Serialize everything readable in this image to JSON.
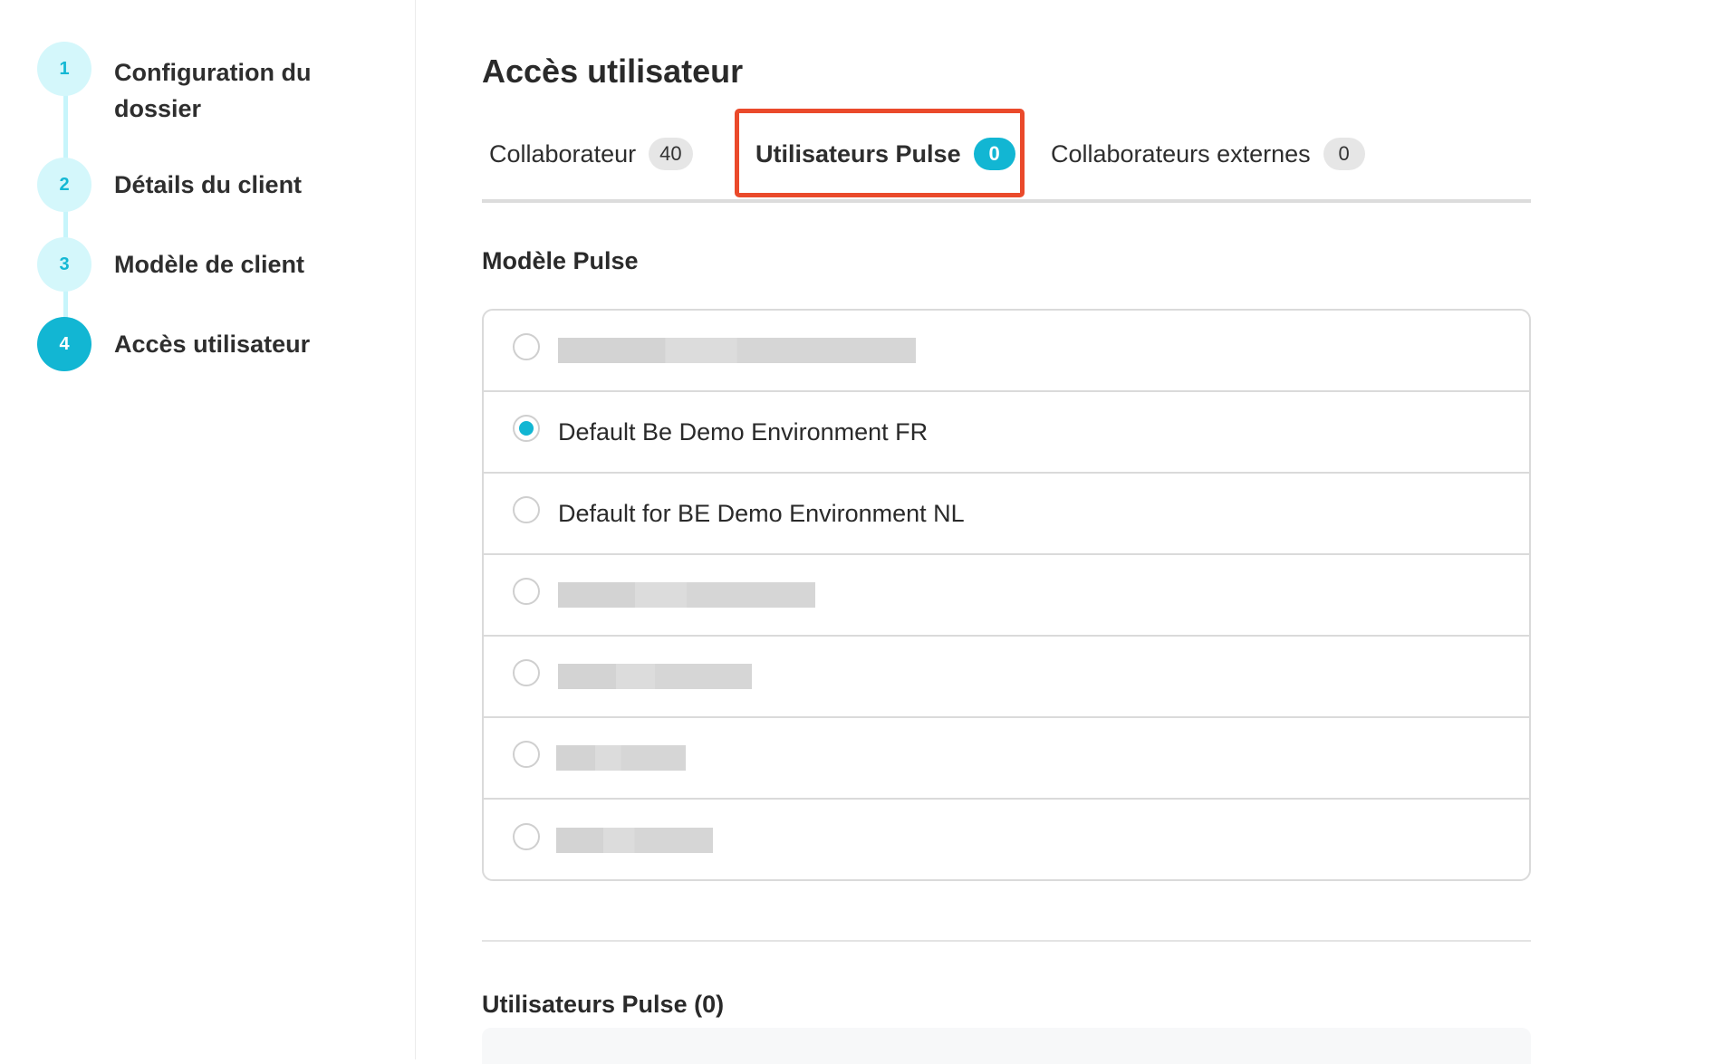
{
  "steps": [
    {
      "number": "1",
      "label": "Configuration du dossier",
      "active": false
    },
    {
      "number": "2",
      "label": "Détails du client",
      "active": false
    },
    {
      "number": "3",
      "label": "Modèle de client",
      "active": false
    },
    {
      "number": "4",
      "label": "Accès utilisateur",
      "active": true
    }
  ],
  "page_title": "Accès utilisateur",
  "tabs": [
    {
      "label": "Collaborateur",
      "count": "40",
      "active": false
    },
    {
      "label": "Utilisateurs Pulse",
      "count": "0",
      "active": true
    },
    {
      "label": "Collaborateurs externes",
      "count": "0",
      "active": false
    }
  ],
  "model_section_title": "Modèle Pulse",
  "models": [
    {
      "label": "",
      "redacted": true,
      "checked": false
    },
    {
      "label": "Default Be Demo Environment FR",
      "redacted": false,
      "checked": true
    },
    {
      "label": "Default for BE Demo Environment NL",
      "redacted": false,
      "checked": false
    },
    {
      "label": "",
      "redacted": true,
      "checked": false
    },
    {
      "label": "",
      "redacted": true,
      "checked": false
    },
    {
      "label": "",
      "redacted": true,
      "checked": false
    },
    {
      "label": "",
      "redacted": true,
      "checked": false
    }
  ],
  "users_section_title": "Utilisateurs Pulse (0)",
  "colors": {
    "accent": "#12b6d3",
    "accent_light": "#d4f7fb",
    "highlight": "#ea4a2b"
  }
}
